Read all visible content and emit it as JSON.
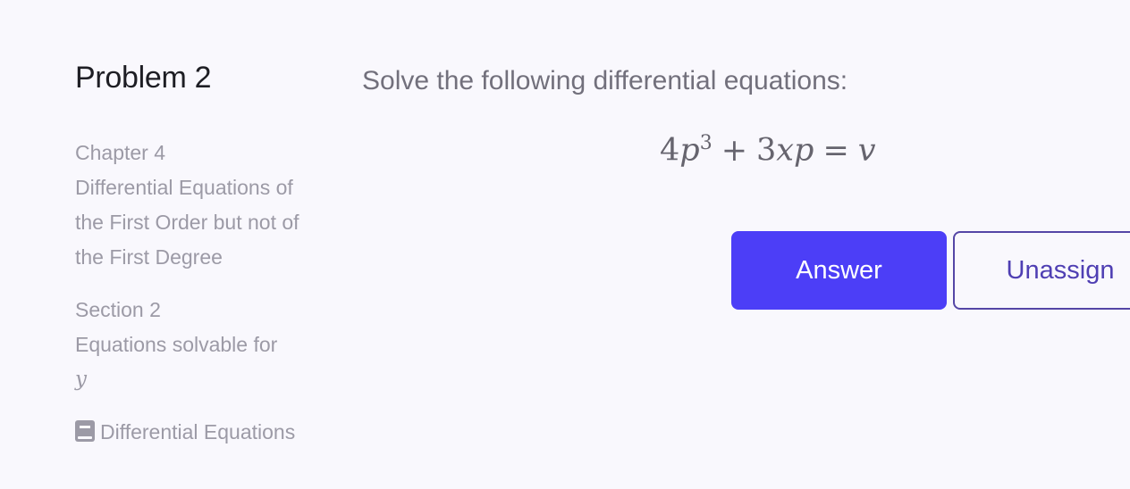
{
  "problem": {
    "title": "Problem 2",
    "prompt": "Solve the following differential equations:",
    "equation": {
      "coef1": "4",
      "var1": "p",
      "exp": "3",
      "plus": "+",
      "coef2": "3",
      "var2": "xp",
      "eq": "=",
      "rhs": "v"
    }
  },
  "sidebar": {
    "chapter_label": "Chapter 4",
    "chapter_title": "Differential Equations of the First Order but not of the First Degree",
    "section_label": "Section 2",
    "section_title": "Equations solvable for",
    "section_var": "y",
    "book_icon": "book-icon",
    "book_title": "Differential Equations"
  },
  "actions": {
    "answer_label": "Answer",
    "unassign_label": "Unassign"
  },
  "colors": {
    "primary": "#4c3ef7",
    "outline": "#5546a6",
    "background": "#f9f8fd"
  }
}
